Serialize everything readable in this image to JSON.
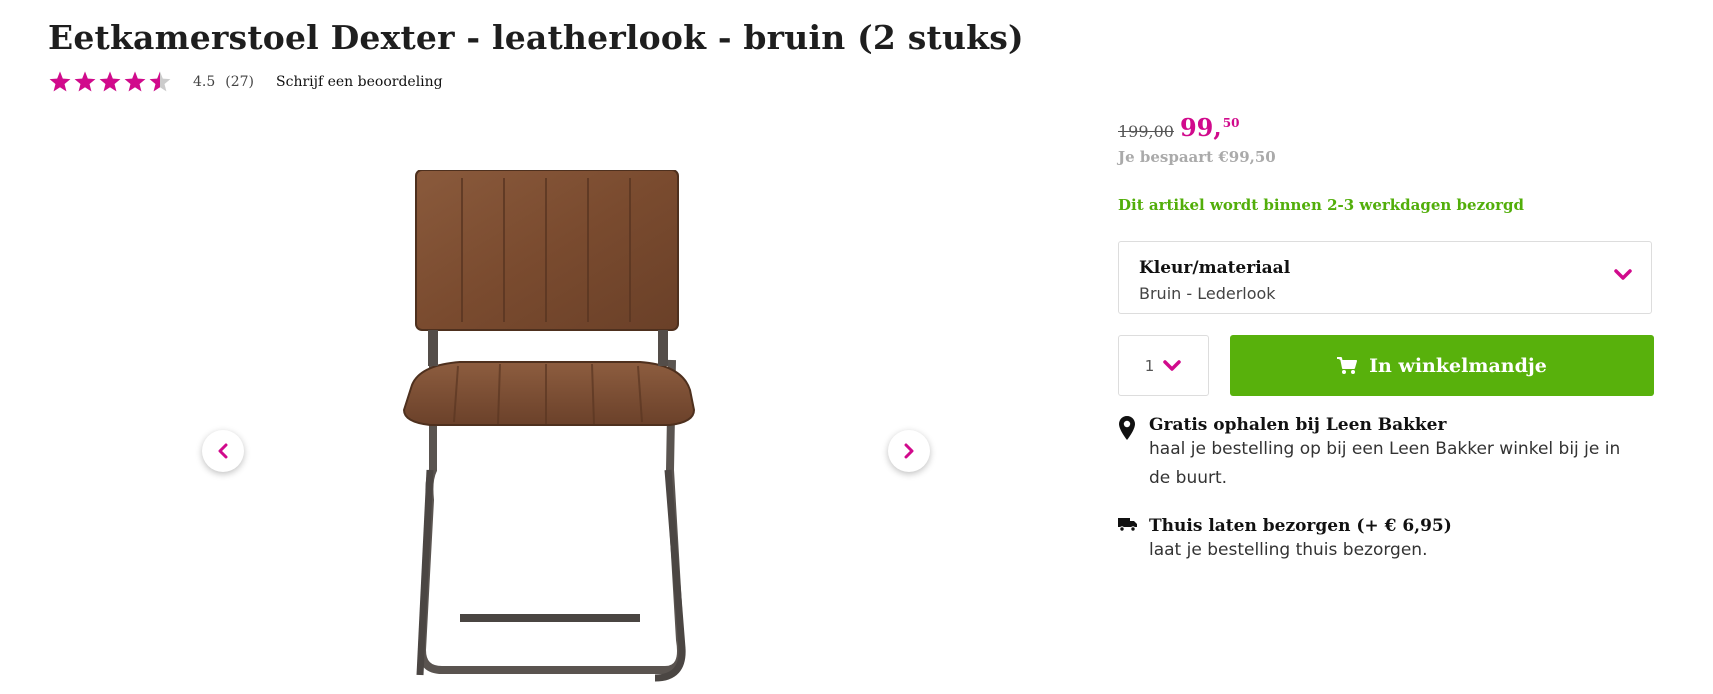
{
  "product": {
    "title": "Eetkamerstoel Dexter - leatherlook - bruin (2 stuks)",
    "rating": {
      "score": 4.5,
      "score_text": "4.5",
      "count_text": "(27)",
      "stars_out_of": 5
    },
    "write_review_label": "Schrijf een beoordeling"
  },
  "pricing": {
    "old_price": "199,00",
    "new_price_main": "99,",
    "new_price_cents": "50",
    "savings": "Je bespaart €99,50"
  },
  "delivery_note": "Dit artikel wordt binnen 2-3 werkdagen bezorgd",
  "variant": {
    "label": "Kleur/materiaal",
    "value": "Bruin - Lederlook"
  },
  "quantity": {
    "value": "1"
  },
  "cart_button": {
    "label": "In winkelmandje"
  },
  "pickup": {
    "title": "Gratis ophalen bij Leen Bakker",
    "text_line1": "haal je bestelling op bij een Leen Bakker winkel bij je in",
    "text_line2": "de buurt."
  },
  "home_delivery": {
    "title": "Thuis laten bezorgen (+ € 6,95)",
    "text": "laat je bestelling thuis bezorgen."
  },
  "colors": {
    "accent_magenta": "#d10a8c",
    "green": "#58b10c",
    "star_empty": "#cccccc"
  },
  "icons": {
    "prev": "chevron-left-icon",
    "next": "chevron-right-icon",
    "dropdown": "chevron-down-icon",
    "cart": "shopping-cart-icon",
    "pickup": "map-pin-icon",
    "delivery": "truck-icon"
  }
}
